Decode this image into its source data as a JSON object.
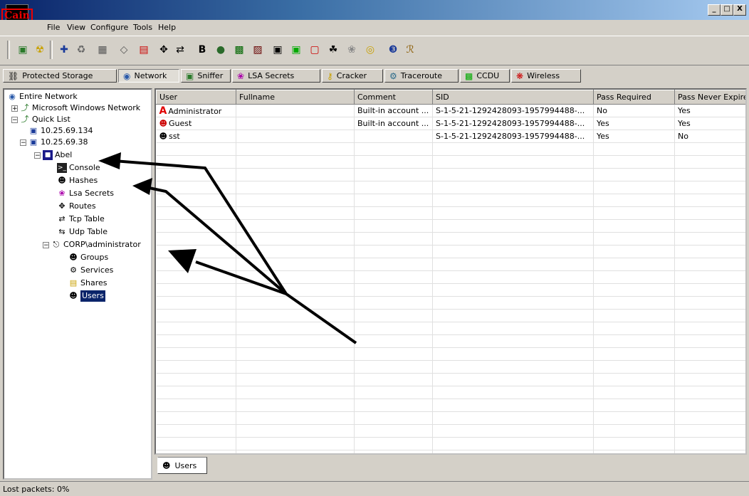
{
  "app": {
    "logo_text": "Cain"
  },
  "window_controls": {
    "minimize": "_",
    "maximize": "□",
    "close": "X"
  },
  "menu": [
    "File",
    "View",
    "Configure",
    "Tools",
    "Help"
  ],
  "tabs": [
    {
      "label": "Protected Storage",
      "icon": "storage-icon"
    },
    {
      "label": "Network",
      "icon": "network-icon"
    },
    {
      "label": "Sniffer",
      "icon": "sniffer-icon"
    },
    {
      "label": "LSA Secrets",
      "icon": "lsa-icon"
    },
    {
      "label": "Cracker",
      "icon": "cracker-icon"
    },
    {
      "label": "Traceroute",
      "icon": "traceroute-icon"
    },
    {
      "label": "CCDU",
      "icon": "ccdu-icon"
    },
    {
      "label": "Wireless",
      "icon": "wireless-icon"
    }
  ],
  "tree": {
    "entire_network": "Entire Network",
    "ms_network": "Microsoft Windows Network",
    "quick_list": "Quick List",
    "host1": "10.25.69.134",
    "host2": "10.25.69.38",
    "abel": "Abel",
    "abel_children": [
      "Console",
      "Hashes",
      "Lsa Secrets",
      "Routes",
      "Tcp Table",
      "Udp Table"
    ],
    "corp": "CORP\\administrator",
    "corp_children": [
      "Groups",
      "Services",
      "Shares",
      "Users"
    ]
  },
  "table": {
    "columns": [
      "User",
      "Fullname",
      "Comment",
      "SID",
      "Pass Required",
      "Pass Never Expire"
    ],
    "rows": [
      [
        "Administrator",
        "",
        "Built-in account ...",
        "S-1-5-21-1292428093-1957994488-...",
        "No",
        "Yes"
      ],
      [
        "Guest",
        "",
        "Built-in account ...",
        "S-1-5-21-1292428093-1957994488-...",
        "Yes",
        "Yes"
      ],
      [
        "sst",
        "",
        "",
        "S-1-5-21-1292428093-1957994488-...",
        "Yes",
        "No"
      ]
    ]
  },
  "bottom_tab": "Users",
  "status": {
    "lost_packets": "Lost packets:  0%"
  },
  "colors": {
    "title_dark": "#0a246a",
    "selection": "#0a246a",
    "admin_icon": "#e00000"
  }
}
